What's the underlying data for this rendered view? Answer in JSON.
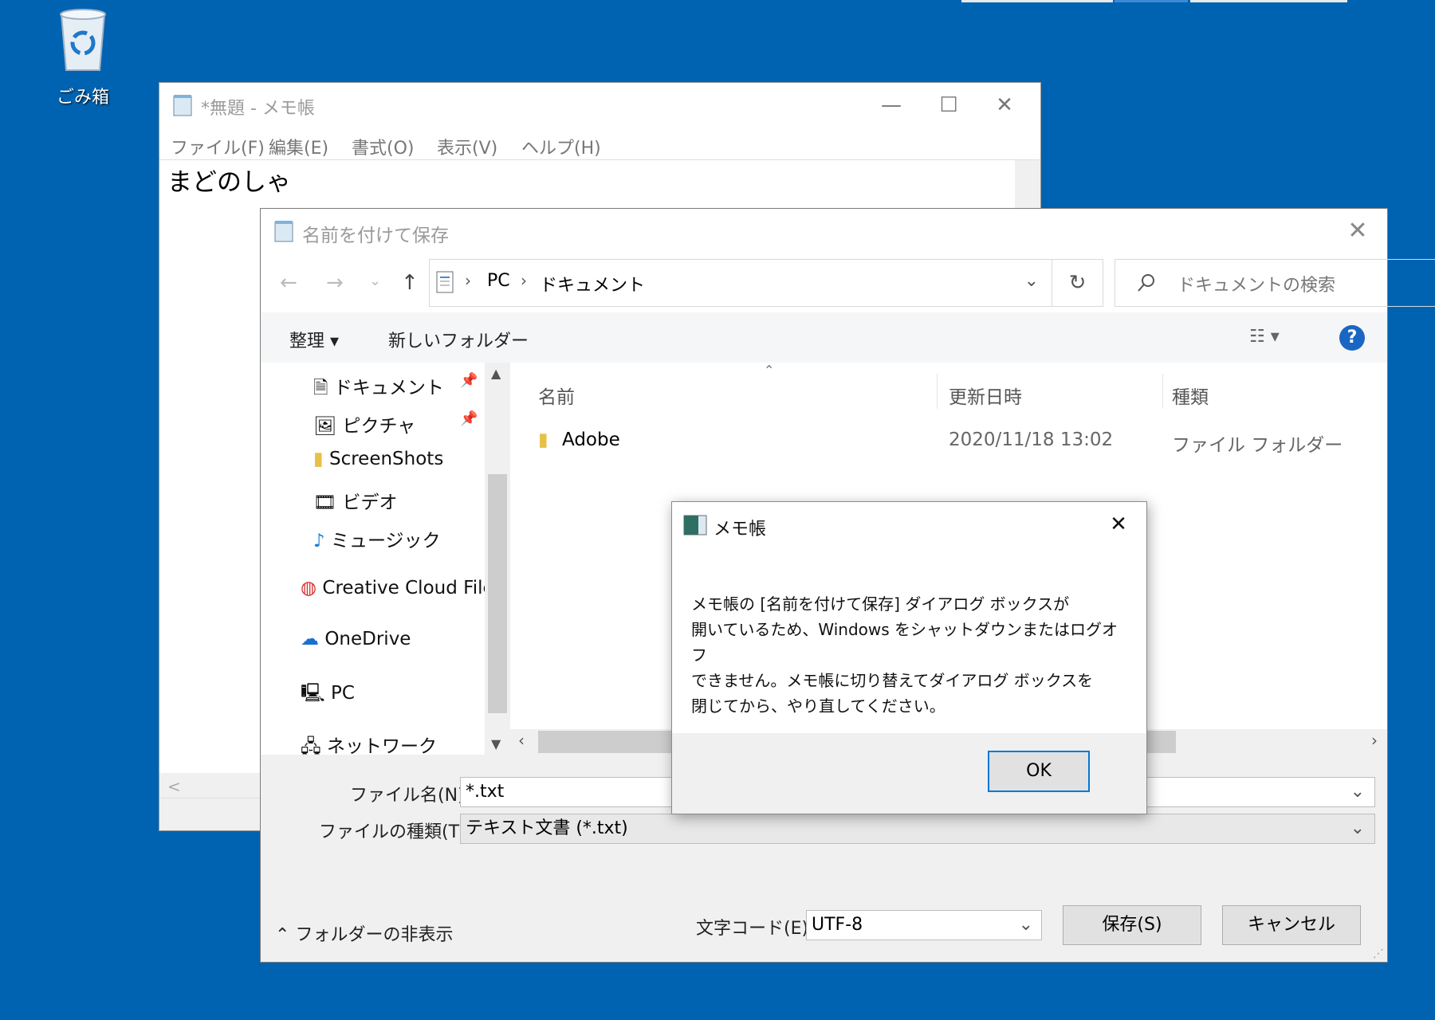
{
  "desktop": {
    "recycle_bin_label": "ごみ箱"
  },
  "notepad": {
    "title": "*無題 - メモ帳",
    "menu": [
      "ファイル(F)",
      "編集(E)",
      "書式(O)",
      "表示(V)",
      "ヘルプ(H)"
    ],
    "content": "まどのしゃ",
    "hscroll_left": "<"
  },
  "save_dialog": {
    "title": "名前を付けて保存",
    "breadcrumb": [
      "PC",
      "ドキュメント"
    ],
    "search_placeholder": "ドキュメントの検索",
    "toolbar": {
      "organize": "整理",
      "new_folder": "新しいフォルダー"
    },
    "nav_items": [
      "ドキュメント",
      "ピクチャ",
      "ScreenShots",
      "ビデオ",
      "ミュージック",
      "Creative Cloud Files",
      "OneDrive",
      "PC",
      "ネットワーク"
    ],
    "columns": {
      "name": "名前",
      "modified": "更新日時",
      "type": "種類"
    },
    "files": [
      {
        "name": "Adobe",
        "modified": "2020/11/18 13:02",
        "type": "ファイル フォルダー"
      }
    ],
    "filename_label": "ファイル名(N):",
    "filename_value": "*.txt",
    "filetype_label": "ファイルの種類(T):",
    "filetype_value": "テキスト文書 (*.txt)",
    "hide_folders": "フォルダーの非表示",
    "encoding_label": "文字コード(E):",
    "encoding_value": "UTF-8",
    "save_button": "保存(S)",
    "cancel_button": "キャンセル"
  },
  "alert": {
    "title": "メモ帳",
    "lines": [
      "メモ帳の [名前を付けて保存] ダイアログ ボックスが",
      "開いているため、Windows をシャットダウンまたはログオフ",
      "できません。メモ帳に切り替えてダイアログ ボックスを",
      "閉じてから、やり直してください。"
    ],
    "ok_button": "OK"
  },
  "colors": {
    "desktop": "#0063B1",
    "accent": "#0078d7",
    "help": "#1a66c2"
  }
}
